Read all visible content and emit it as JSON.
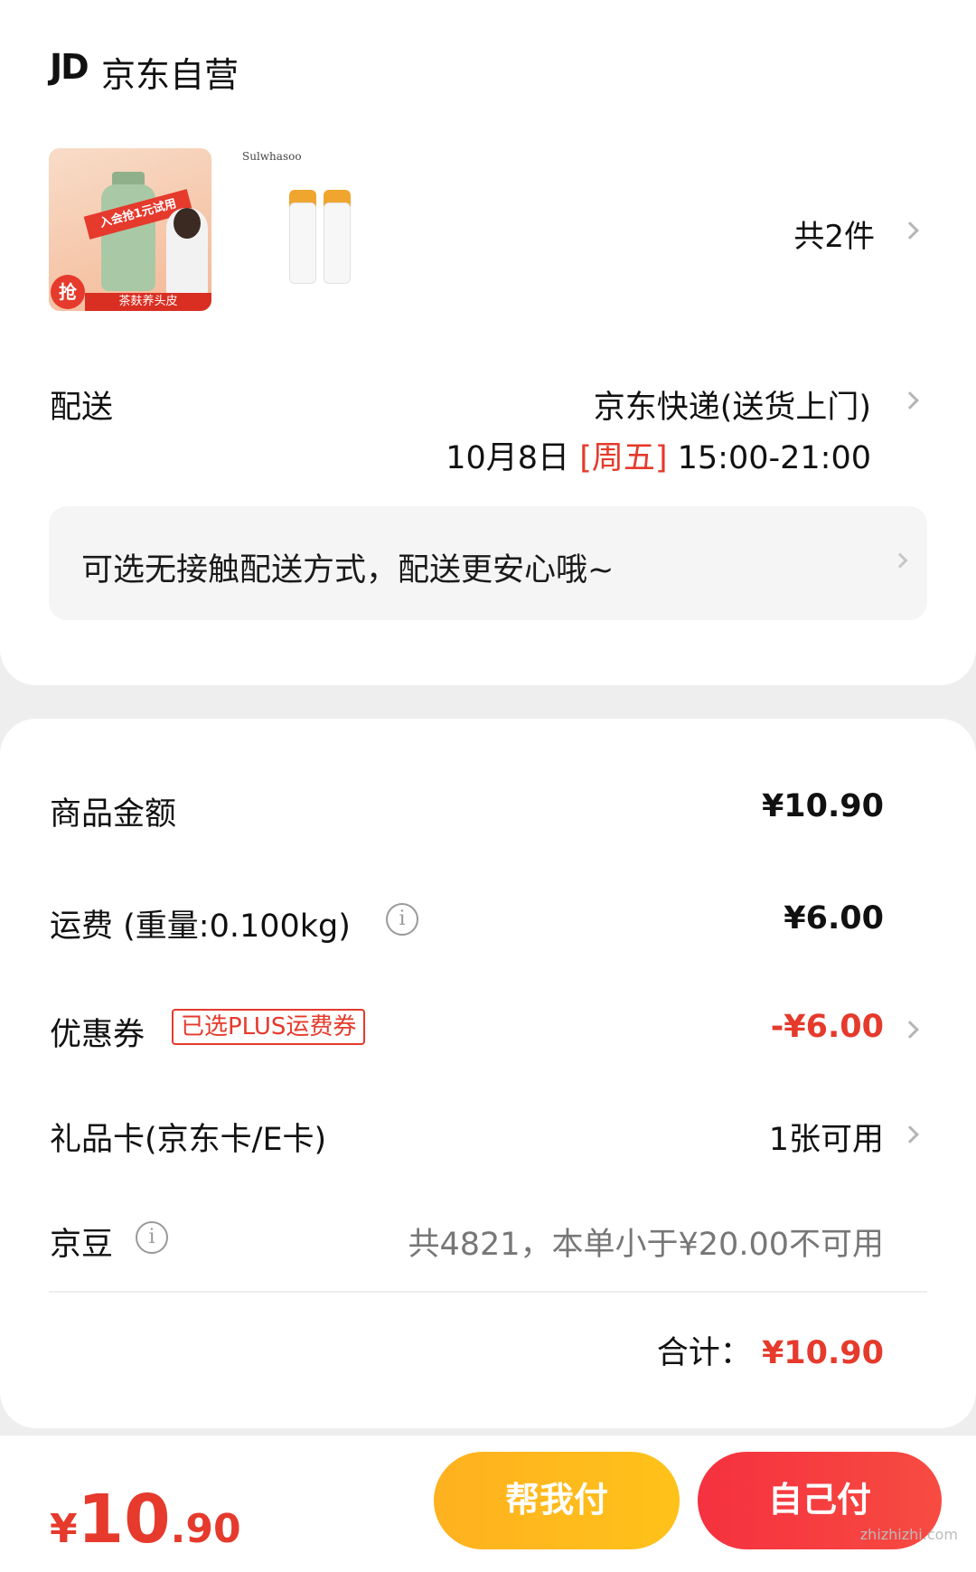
{
  "store": {
    "logo": "JD",
    "name": "京东自营"
  },
  "products": {
    "thumb1": {
      "ribbon": "入会抢1元试用",
      "grab": "抢",
      "bar": "茶麸养头皮"
    },
    "thumb2": {
      "brand": "Sulwhasoo"
    },
    "count_label": "共2件"
  },
  "delivery": {
    "label": "配送",
    "method": "京东快递(送货上门)",
    "date": "10月8日",
    "weekday": "[周五]",
    "time": "15:00-21:00",
    "notice": "可选无接触配送方式，配送更安心哦~"
  },
  "price": {
    "goods_label": "商品金额",
    "goods_value": "¥10.90",
    "shipping_label": "运费 (重量:0.100kg)",
    "shipping_value": "¥6.00",
    "coupon_label": "优惠券",
    "coupon_tag": "已选PLUS运费券",
    "coupon_value": "-¥6.00",
    "giftcard_label": "礼品卡(京东卡/E卡)",
    "giftcard_value": "1张可用",
    "beans_label": "京豆",
    "beans_value": "共4821，本单小于¥20.00不可用",
    "total_label": "合计：",
    "total_value": "¥10.90"
  },
  "footer": {
    "currency": "¥",
    "amount_int": "10",
    "amount_dec": ".90",
    "help_pay": "帮我付",
    "self_pay": "自己付",
    "watermark": "zhizhizhi.com"
  },
  "colors": {
    "accent_red": "#e53a2c",
    "help_btn": "#ffb11f",
    "self_btn": "#f5313f"
  }
}
